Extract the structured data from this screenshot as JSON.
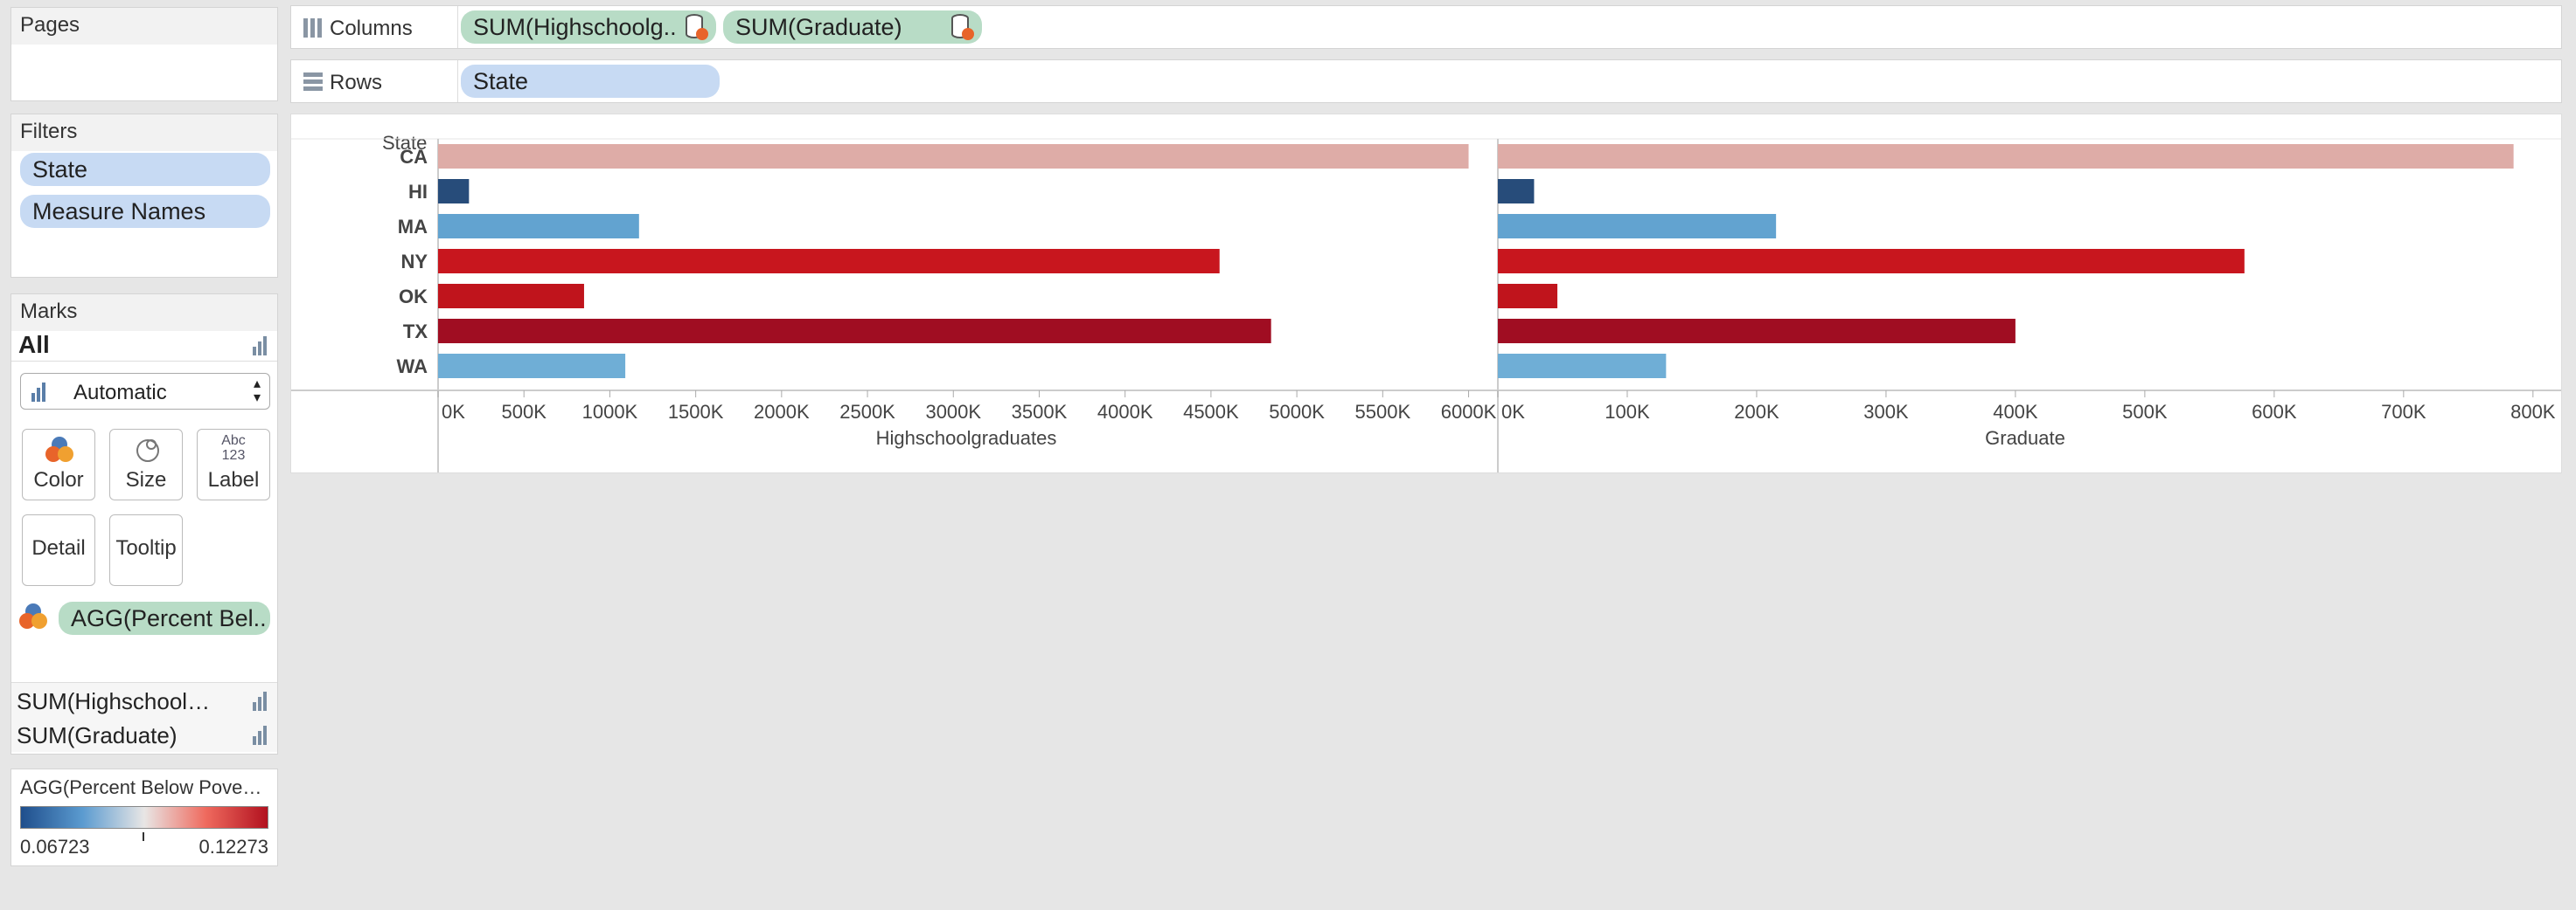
{
  "pages": {
    "title": "Pages"
  },
  "filters": {
    "title": "Filters",
    "items": [
      "State",
      "Measure Names"
    ]
  },
  "marks": {
    "title": "Marks",
    "all_label": "All",
    "mark_type": "Automatic",
    "cards": [
      "Color",
      "Size",
      "Label",
      "Detail",
      "Tooltip"
    ],
    "label_icon_text": [
      "Abc",
      "123"
    ],
    "color_field": "AGG(Percent Bel..",
    "measures": [
      "SUM(Highschool…",
      "SUM(Graduate)"
    ]
  },
  "legend": {
    "title": "AGG(Percent Below Pove…",
    "min": "0.06723",
    "max": "0.12273",
    "colors": [
      "#1f4e8c",
      "#5b9bd0",
      "#e8e6e5",
      "#ef6a5e",
      "#b2111f"
    ]
  },
  "shelves": {
    "columns_label": "Columns",
    "columns": [
      "SUM(Highschoolg..",
      "SUM(Graduate)"
    ],
    "rows_label": "Rows",
    "rows": [
      "State"
    ]
  },
  "chart_data": {
    "type": "bar",
    "orientation": "horizontal",
    "row_header": "State",
    "categories": [
      "CA",
      "HI",
      "MA",
      "NY",
      "OK",
      "TX",
      "WA"
    ],
    "color_values": [
      0.0915,
      0.0672,
      0.0765,
      0.1185,
      0.1175,
      0.1227,
      0.0805
    ],
    "colors": [
      "#deaca7",
      "#274c7a",
      "#62a3d0",
      "#c8161e",
      "#c0141c",
      "#a00d22",
      "#6faed6"
    ],
    "series": [
      {
        "name": "Highschoolgraduates",
        "values": [
          6000,
          180,
          1170,
          4550,
          850,
          4850,
          1090
        ],
        "ticks": [
          "0K",
          "500K",
          "1000K",
          "1500K",
          "2000K",
          "2500K",
          "3000K",
          "3500K",
          "4000K",
          "4500K",
          "5000K",
          "5500K",
          "6000K"
        ],
        "xlim": [
          0,
          6150
        ]
      },
      {
        "name": "Graduate",
        "values": [
          785,
          28,
          215,
          577,
          46,
          400,
          130
        ],
        "ticks": [
          "0K",
          "100K",
          "200K",
          "300K",
          "400K",
          "500K",
          "600K",
          "700K",
          "800K"
        ],
        "xlim": [
          0,
          815
        ]
      }
    ]
  }
}
